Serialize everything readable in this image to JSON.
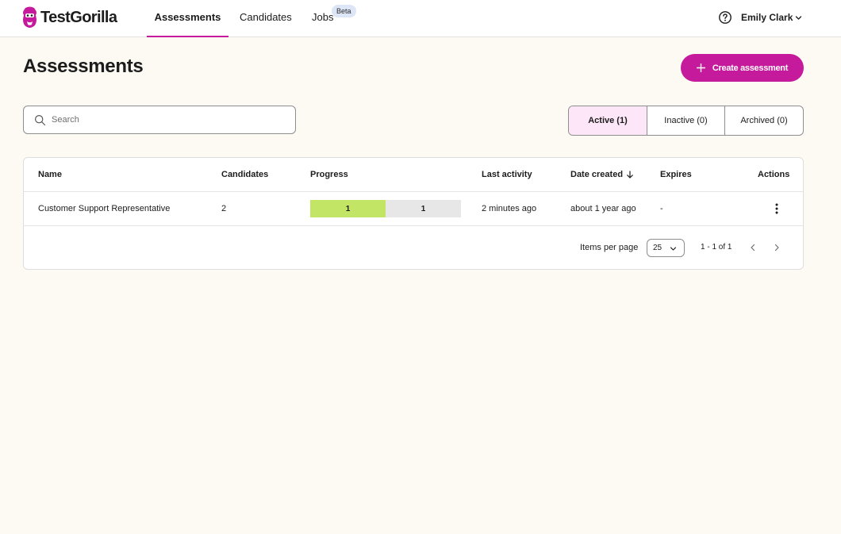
{
  "app": {
    "brand": "TestGorilla"
  },
  "nav": {
    "tabs": [
      {
        "label": "Assessments",
        "active": true
      },
      {
        "label": "Candidates",
        "active": false
      },
      {
        "label": "Jobs",
        "active": false,
        "badge": "Beta"
      }
    ]
  },
  "user": {
    "name": "Emily Clark"
  },
  "page": {
    "title": "Assessments",
    "create_label": "Create assessment"
  },
  "search": {
    "placeholder": "Search",
    "value": ""
  },
  "filters": [
    {
      "label": "Active (1)",
      "active": true
    },
    {
      "label": "Inactive (0)",
      "active": false
    },
    {
      "label": "Archived (0)",
      "active": false
    }
  ],
  "table": {
    "columns": [
      "Name",
      "Candidates",
      "Progress",
      "Last activity",
      "Date created",
      "Expires",
      "Actions"
    ],
    "sort": {
      "column": "Date created",
      "direction": "desc"
    },
    "rows": [
      {
        "name": "Customer Support Representative",
        "candidates": "2",
        "progress": {
          "completed": "1",
          "remaining": "1",
          "completed_fraction": 0.5
        },
        "last_activity": "2 minutes ago",
        "date_created": "about 1 year ago",
        "expires": "-"
      }
    ]
  },
  "pagination": {
    "items_per_page_label": "Items per page",
    "items_per_page": "25",
    "range": "1 - 1 of 1"
  },
  "colors": {
    "brand": "#c51a9b",
    "active_filter_bg": "#fce6f7",
    "progress_completed": "#c3e566",
    "progress_remaining": "#e7e7e7",
    "page_bg": "#fdfaf4",
    "badge_bg": "#dce6f7"
  },
  "icons": [
    "gorilla-logo-icon",
    "help-circle-icon",
    "chevron-down-icon",
    "plus-icon",
    "search-icon",
    "arrow-down-icon",
    "more-vertical-icon",
    "chevron-left-icon",
    "chevron-right-icon"
  ]
}
